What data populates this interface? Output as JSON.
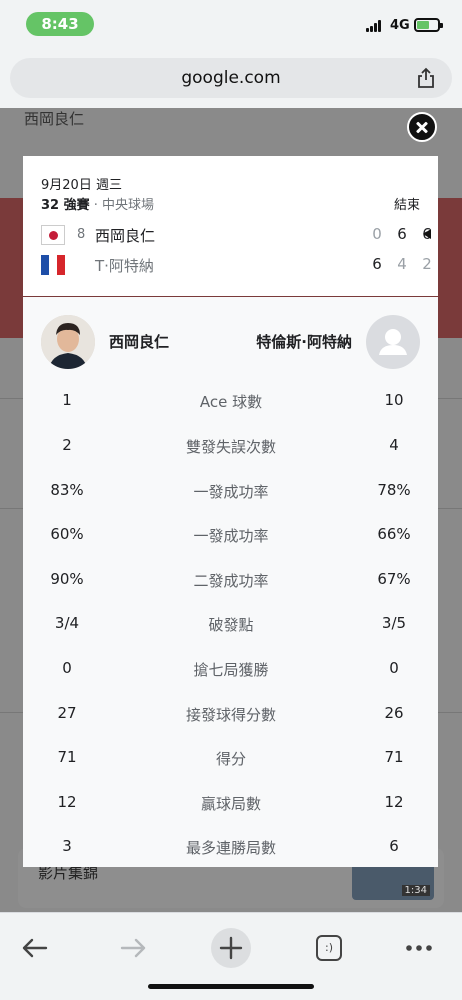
{
  "status_bar": {
    "time": "8:43",
    "network": "4G"
  },
  "browser": {
    "url": "google.com"
  },
  "background": {
    "search_text": "西岡良仁",
    "card_label": "影片集錦",
    "video_duration": "1:34"
  },
  "match": {
    "date": "9月20日 週三",
    "round": "32 強賽",
    "court": " · 中央球場",
    "status": "結束",
    "players": [
      {
        "name": "西岡良仁",
        "seed": "8",
        "flag": "japan-flag-icon",
        "sets": [
          "0",
          "6",
          "6"
        ],
        "set_wins": [
          false,
          true,
          true
        ],
        "winner": true
      },
      {
        "name": "T·阿特納",
        "seed": "",
        "flag": "france-flag-icon",
        "sets": [
          "6",
          "4",
          "2"
        ],
        "set_wins": [
          true,
          false,
          false
        ],
        "winner": false
      }
    ]
  },
  "stats": {
    "player_left": "西岡良仁",
    "player_right": "特倫斯·阿特納",
    "rows": [
      {
        "label": "Ace 球數",
        "left": "1",
        "right": "10"
      },
      {
        "label": "雙發失誤次數",
        "left": "2",
        "right": "4"
      },
      {
        "label": "一發成功率",
        "left": "83%",
        "right": "78%"
      },
      {
        "label": "一發成功率",
        "left": "60%",
        "right": "66%"
      },
      {
        "label": "二發成功率",
        "left": "90%",
        "right": "67%"
      },
      {
        "label": "破發點",
        "left": "3/4",
        "right": "3/5"
      },
      {
        "label": "搶七局獲勝",
        "left": "0",
        "right": "0"
      },
      {
        "label": "接發球得分數",
        "left": "27",
        "right": "26"
      },
      {
        "label": "得分",
        "left": "71",
        "right": "71"
      },
      {
        "label": "贏球局數",
        "left": "12",
        "right": "12"
      },
      {
        "label": "最多連勝局數",
        "left": "3",
        "right": "6"
      }
    ]
  },
  "toolbar": {
    "back": "back-arrow-icon",
    "forward": "forward-arrow-icon",
    "new_tab": "plus-icon",
    "tabs": "tabs-icon",
    "tabs_label": ":)",
    "more": "more-dots-icon"
  },
  "colors": {
    "accent_green": "#65c466",
    "japan_red": "#c41e3a",
    "france_blue": "#1e4ea8",
    "france_red": "#d6262b"
  }
}
